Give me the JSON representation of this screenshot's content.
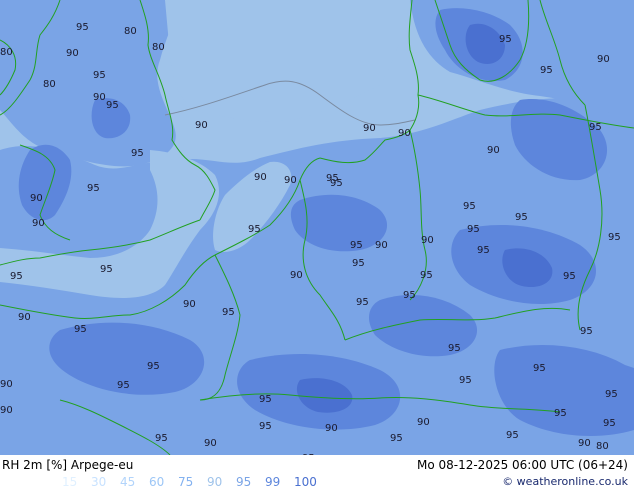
{
  "title": "RH 2m [%] Arpege-eu",
  "datetime": "Mo 08-12-2025 06:00 UTC (06+24)",
  "credit": "© weatheronline.co.uk",
  "legend": {
    "values": [
      "15",
      "30",
      "45",
      "60",
      "75",
      "90",
      "95",
      "99",
      "100"
    ],
    "colors": [
      "#e0f0ff",
      "#c8e2ff",
      "#b2d4fb",
      "#9cc6f6",
      "#84b2f0",
      "#9fc3ea",
      "#7aa4e6",
      "#5d86dc",
      "#4a70d0"
    ]
  },
  "colors": {
    "bg_90": "#9fc3ea",
    "field_95": "#7aa4e6",
    "field_99": "#5d86dc",
    "field_100": "#4a70d0",
    "contour": "#7a8aa0",
    "coast": "#22a022"
  },
  "labels": [
    {
      "text": "95"
    },
    {
      "text": "80"
    },
    {
      "text": "80"
    },
    {
      "text": "90"
    },
    {
      "text": "80"
    },
    {
      "text": "95"
    },
    {
      "text": "80"
    },
    {
      "text": "90"
    },
    {
      "text": "95"
    },
    {
      "text": "90"
    },
    {
      "text": "95"
    },
    {
      "text": "90"
    },
    {
      "text": "90"
    },
    {
      "text": "90"
    },
    {
      "text": "90"
    },
    {
      "text": "95"
    },
    {
      "text": "90"
    },
    {
      "text": "95"
    },
    {
      "text": "90"
    },
    {
      "text": "95"
    },
    {
      "text": "95"
    },
    {
      "text": "90"
    },
    {
      "text": "95"
    },
    {
      "text": "95"
    },
    {
      "text": "95"
    },
    {
      "text": "90"
    },
    {
      "text": "95"
    },
    {
      "text": "95"
    },
    {
      "text": "95"
    },
    {
      "text": "95"
    },
    {
      "text": "90"
    },
    {
      "text": "95"
    },
    {
      "text": "95"
    },
    {
      "text": "95"
    },
    {
      "text": "95"
    },
    {
      "text": "90"
    },
    {
      "text": "95"
    },
    {
      "text": "90"
    },
    {
      "text": "95"
    },
    {
      "text": "95"
    },
    {
      "text": "95"
    },
    {
      "text": "95"
    },
    {
      "text": "95"
    },
    {
      "text": "95"
    },
    {
      "text": "90"
    },
    {
      "text": "95"
    },
    {
      "text": "90"
    },
    {
      "text": "95"
    },
    {
      "text": "90"
    },
    {
      "text": "95"
    },
    {
      "text": "95"
    },
    {
      "text": "95"
    },
    {
      "text": "90"
    },
    {
      "text": "95"
    },
    {
      "text": "90"
    },
    {
      "text": "80"
    },
    {
      "text": "95"
    },
    {
      "text": "95"
    },
    {
      "text": "95"
    },
    {
      "text": "95"
    },
    {
      "text": "90"
    },
    {
      "text": "90"
    },
    {
      "text": "95"
    },
    {
      "text": "95"
    },
    {
      "text": "95"
    },
    {
      "text": "90"
    },
    {
      "text": "95"
    },
    {
      "text": "95"
    }
  ]
}
